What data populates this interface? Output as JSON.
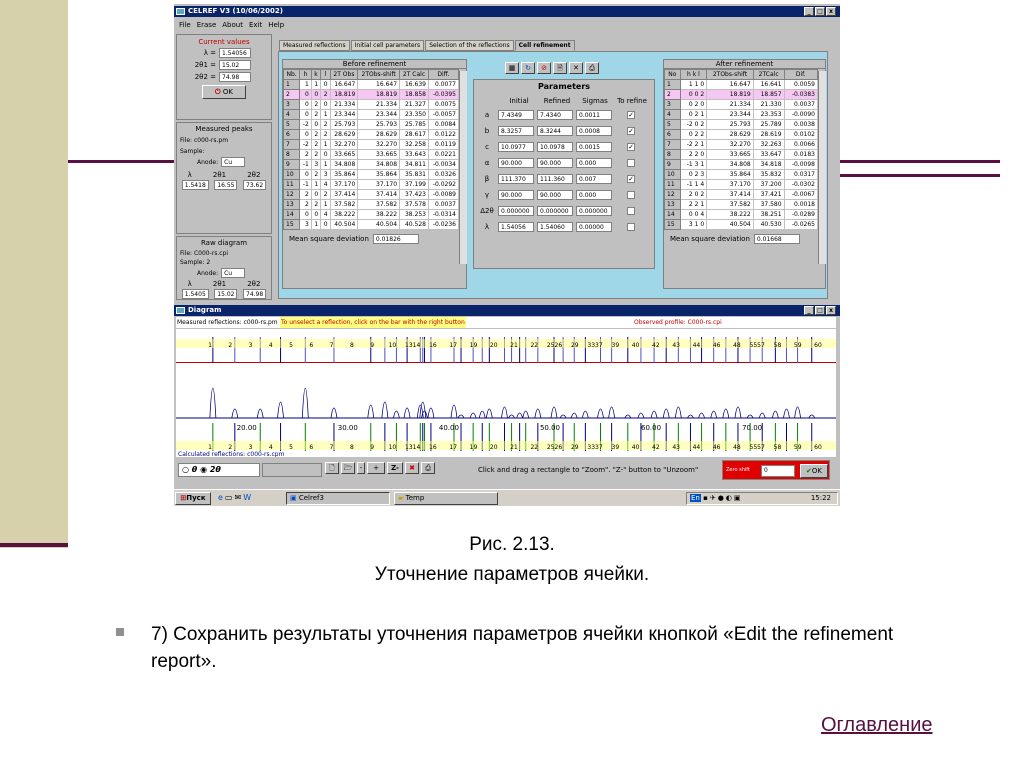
{
  "app": {
    "title": "CELREF V3 (10/06/2002)",
    "menu": [
      "File",
      "Erase",
      "About",
      "Exit",
      "Help"
    ],
    "win_buttons": [
      "_",
      "□",
      "x"
    ]
  },
  "current_values": {
    "title": "Current values",
    "lambda_label": "λ =",
    "lambda": "1.54056",
    "theta1_label": "2θ1 =",
    "theta1": "15.02",
    "theta2_label": "2θ2 =",
    "theta2": "74.98",
    "ok": "OK"
  },
  "measured_peaks": {
    "title": "Measured peaks",
    "file": "File: c000-rs.pm",
    "sample": "Sample:",
    "anode_label": "Anode:",
    "anode": "Cu",
    "col_lambda": "λ",
    "col_t1": "2θ1",
    "col_t2": "2θ2",
    "lambda": "1.5418",
    "t1": "16.55",
    "t2": "73.62"
  },
  "raw_diagram": {
    "title": "Raw diagram",
    "file": "File: C000-rs.cpi",
    "sample": "Sample: 2",
    "anode_label": "Anode:",
    "anode": "Cu",
    "col_lambda": "λ",
    "col_t1": "2θ1",
    "col_t2": "2θ2",
    "lambda": "1.5405",
    "t1": "15.02",
    "t2": "74.98"
  },
  "tabs": [
    "Measured reflections",
    "Initial cell parameters",
    "Selection of the reflections",
    "Cell refinement"
  ],
  "before": {
    "title": "Before refinement",
    "headers": [
      "Nb.",
      "h",
      "k",
      "l",
      "2T Obs",
      "2TObs-shift",
      "2T Calc",
      "Diff."
    ],
    "rows": [
      [
        "1",
        "1",
        "1",
        "0",
        "16.647",
        "16.647",
        "16.639",
        "0.0077"
      ],
      [
        "2",
        "0",
        "0",
        "2",
        "18.819",
        "18.819",
        "18.858",
        "-0.0395"
      ],
      [
        "3",
        "0",
        "2",
        "0",
        "21.334",
        "21.334",
        "21.327",
        "0.0075"
      ],
      [
        "4",
        "0",
        "2",
        "1",
        "23.344",
        "23.344",
        "23.350",
        "-0.0057"
      ],
      [
        "5",
        "-2",
        "0",
        "2",
        "25.793",
        "25.793",
        "25.785",
        "0.0084"
      ],
      [
        "6",
        "0",
        "2",
        "2",
        "28.629",
        "28.629",
        "28.617",
        "0.0122"
      ],
      [
        "7",
        "-2",
        "2",
        "1",
        "32.270",
        "32.270",
        "32.258",
        "0.0119"
      ],
      [
        "8",
        "2",
        "2",
        "0",
        "33.665",
        "33.665",
        "33.643",
        "0.0221"
      ],
      [
        "9",
        "-1",
        "3",
        "1",
        "34.808",
        "34.808",
        "34.811",
        "-0.0034"
      ],
      [
        "10",
        "0",
        "2",
        "3",
        "35.864",
        "35.864",
        "35.831",
        "0.0326"
      ],
      [
        "11",
        "-1",
        "1",
        "4",
        "37.170",
        "37.170",
        "37.199",
        "-0.0292"
      ],
      [
        "12",
        "2",
        "0",
        "2",
        "37.414",
        "37.414",
        "37.423",
        "-0.0089"
      ],
      [
        "13",
        "2",
        "2",
        "1",
        "37.582",
        "37.582",
        "37.578",
        "0.0037"
      ],
      [
        "14",
        "0",
        "0",
        "4",
        "38.222",
        "38.222",
        "38.253",
        "-0.0314"
      ],
      [
        "15",
        "3",
        "1",
        "0",
        "40.504",
        "40.504",
        "40.528",
        "-0.0236"
      ]
    ],
    "msd_label": "Mean square deviation",
    "msd": "0.01826"
  },
  "parameters": {
    "title": "Parameters",
    "headers": [
      "Initial",
      "Refined",
      "Sigmas",
      "To refine"
    ],
    "rows": [
      {
        "name": "a",
        "initial": "7.4349",
        "refined": "7.4340",
        "sigma": "0.0011",
        "refine": true
      },
      {
        "name": "b",
        "initial": "8.3257",
        "refined": "8.3244",
        "sigma": "0.0008",
        "refine": true
      },
      {
        "name": "c",
        "initial": "10.0977",
        "refined": "10.0978",
        "sigma": "0.0015",
        "refine": true
      },
      {
        "name": "α",
        "initial": "90.000",
        "refined": "90.000",
        "sigma": "0.000",
        "refine": false
      },
      {
        "name": "β",
        "initial": "111.370",
        "refined": "111.360",
        "sigma": "0.007",
        "refine": true
      },
      {
        "name": "γ",
        "initial": "90.000",
        "refined": "90.000",
        "sigma": "0.000",
        "refine": false
      },
      {
        "name": "Δ2θ",
        "initial": "0.000000",
        "refined": "0.000000",
        "sigma": "0.000000",
        "refine": false
      },
      {
        "name": "λ",
        "initial": "1.54056",
        "refined": "1.54060",
        "sigma": "0.00000",
        "refine": false
      }
    ],
    "tool_icons": [
      "calculator-icon",
      "refresh-icon",
      "stop-icon",
      "report-icon",
      "tools-icon",
      "print-icon"
    ]
  },
  "after": {
    "title": "After refinement",
    "headers": [
      "No",
      "h k l",
      "2TObs-shift",
      "2TCalc",
      "Dif."
    ],
    "rows": [
      [
        "1",
        "1 1 0",
        "16.647",
        "16.641",
        "0.0059"
      ],
      [
        "2",
        "0 0 2",
        "18.819",
        "18.857",
        "-0.0383"
      ],
      [
        "3",
        "0 2 0",
        "21.334",
        "21.330",
        "0.0037"
      ],
      [
        "4",
        "0 2 1",
        "23.344",
        "23.353",
        "-0.0090"
      ],
      [
        "5",
        "-2 0 2",
        "25.793",
        "25.789",
        "0.0038"
      ],
      [
        "6",
        "0 2 2",
        "28.629",
        "28.619",
        "0.0102"
      ],
      [
        "7",
        "-2 2 1",
        "32.270",
        "32.263",
        "0.0066"
      ],
      [
        "8",
        "2 2 0",
        "33.665",
        "33.647",
        "0.0183"
      ],
      [
        "9",
        "-1 3 1",
        "34.808",
        "34.818",
        "-0.0098"
      ],
      [
        "10",
        "0 2 3",
        "35.864",
        "35.832",
        "0.0317"
      ],
      [
        "11",
        "-1 1 4",
        "37.170",
        "37.200",
        "-0.0302"
      ],
      [
        "12",
        "2 0 2",
        "37.414",
        "37.421",
        "-0.0067"
      ],
      [
        "13",
        "2 2 1",
        "37.582",
        "37.580",
        "0.0018"
      ],
      [
        "14",
        "0 0 4",
        "38.222",
        "38.251",
        "-0.0289"
      ],
      [
        "15",
        "3 1 0",
        "40.504",
        "40.530",
        "-0.0265"
      ]
    ],
    "msd_label": "Mean square deviation",
    "msd": "0.01668"
  },
  "diagram": {
    "title": "Diagram",
    "measured_label": "Measured reflections: c000-rs.pm",
    "hint": "To unselect a reflection, click on the bar with the right button",
    "observed_label": "Observed profile: C000-rs.cpi",
    "calculated_label": "Calculated reflections: c000-rs.cpm",
    "axis_labels": [
      "20.00",
      "30.00",
      "40.00",
      "50.00",
      "60.00",
      "70.00"
    ],
    "top_labels": [
      "1",
      "2",
      "3",
      "4",
      "5",
      "6",
      "7",
      "8",
      "9",
      "10",
      "1314",
      "16",
      "17",
      "19",
      "20",
      "21",
      "22",
      "2526",
      "29",
      "3337",
      "39",
      "40",
      "42",
      "43",
      "44",
      "46",
      "48",
      "5557",
      "58",
      "59",
      "60"
    ],
    "mode_theta": "θ",
    "mode_2theta": "2θ",
    "status": "Click and drag a rectangle to \"Zoom\".  \"Z-\" button to \"Unzoom\"",
    "zero_shift_label": "Zero shift",
    "zero_shift": "0",
    "ok": "OK",
    "zminus": "Z-",
    "stepper_minus": "-",
    "stepper_plus": "+"
  },
  "taskbar": {
    "start": "Пуск",
    "task1": "Celref3",
    "task2": "Temp",
    "clock": "15:22",
    "lang": "En"
  },
  "slide": {
    "caption1": "Рис. 2.13.",
    "caption2": "Уточнение параметров ячейки.",
    "bullet": "7) Сохранить результаты уточнения параметров ячейки кнопкой «Edit the refinement report».",
    "toc": "Оглавление"
  },
  "colors": {
    "title_bar": "#0a246a",
    "tab_area": "#9fd7e9",
    "selected_row": "#f6c7f3",
    "accent": "#57103f",
    "left_bar": "#d6d0ab",
    "zero_shift_bg": "#e00000"
  }
}
